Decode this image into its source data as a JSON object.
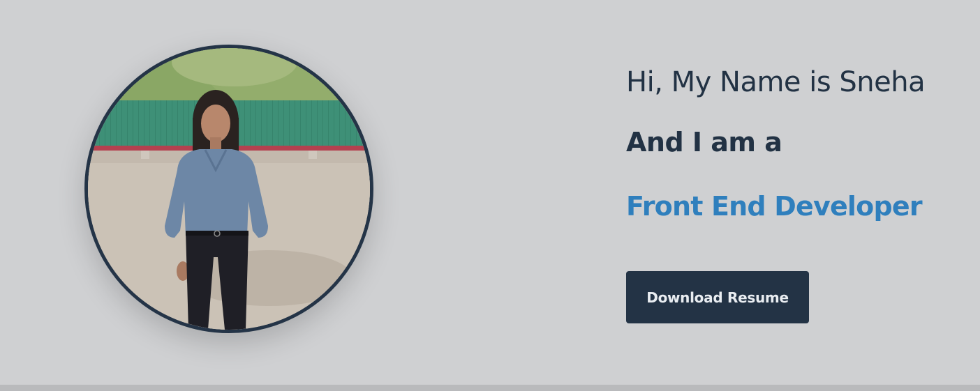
{
  "hero": {
    "greeting": "Hi, My Name is Sneha",
    "lead": "And I am a",
    "role": "Front End Developer",
    "download_label": "Download Resume"
  },
  "colors": {
    "background": "#cfd0d2",
    "primary_text": "#223244",
    "accent": "#2f7fbd",
    "button": "#233345"
  }
}
